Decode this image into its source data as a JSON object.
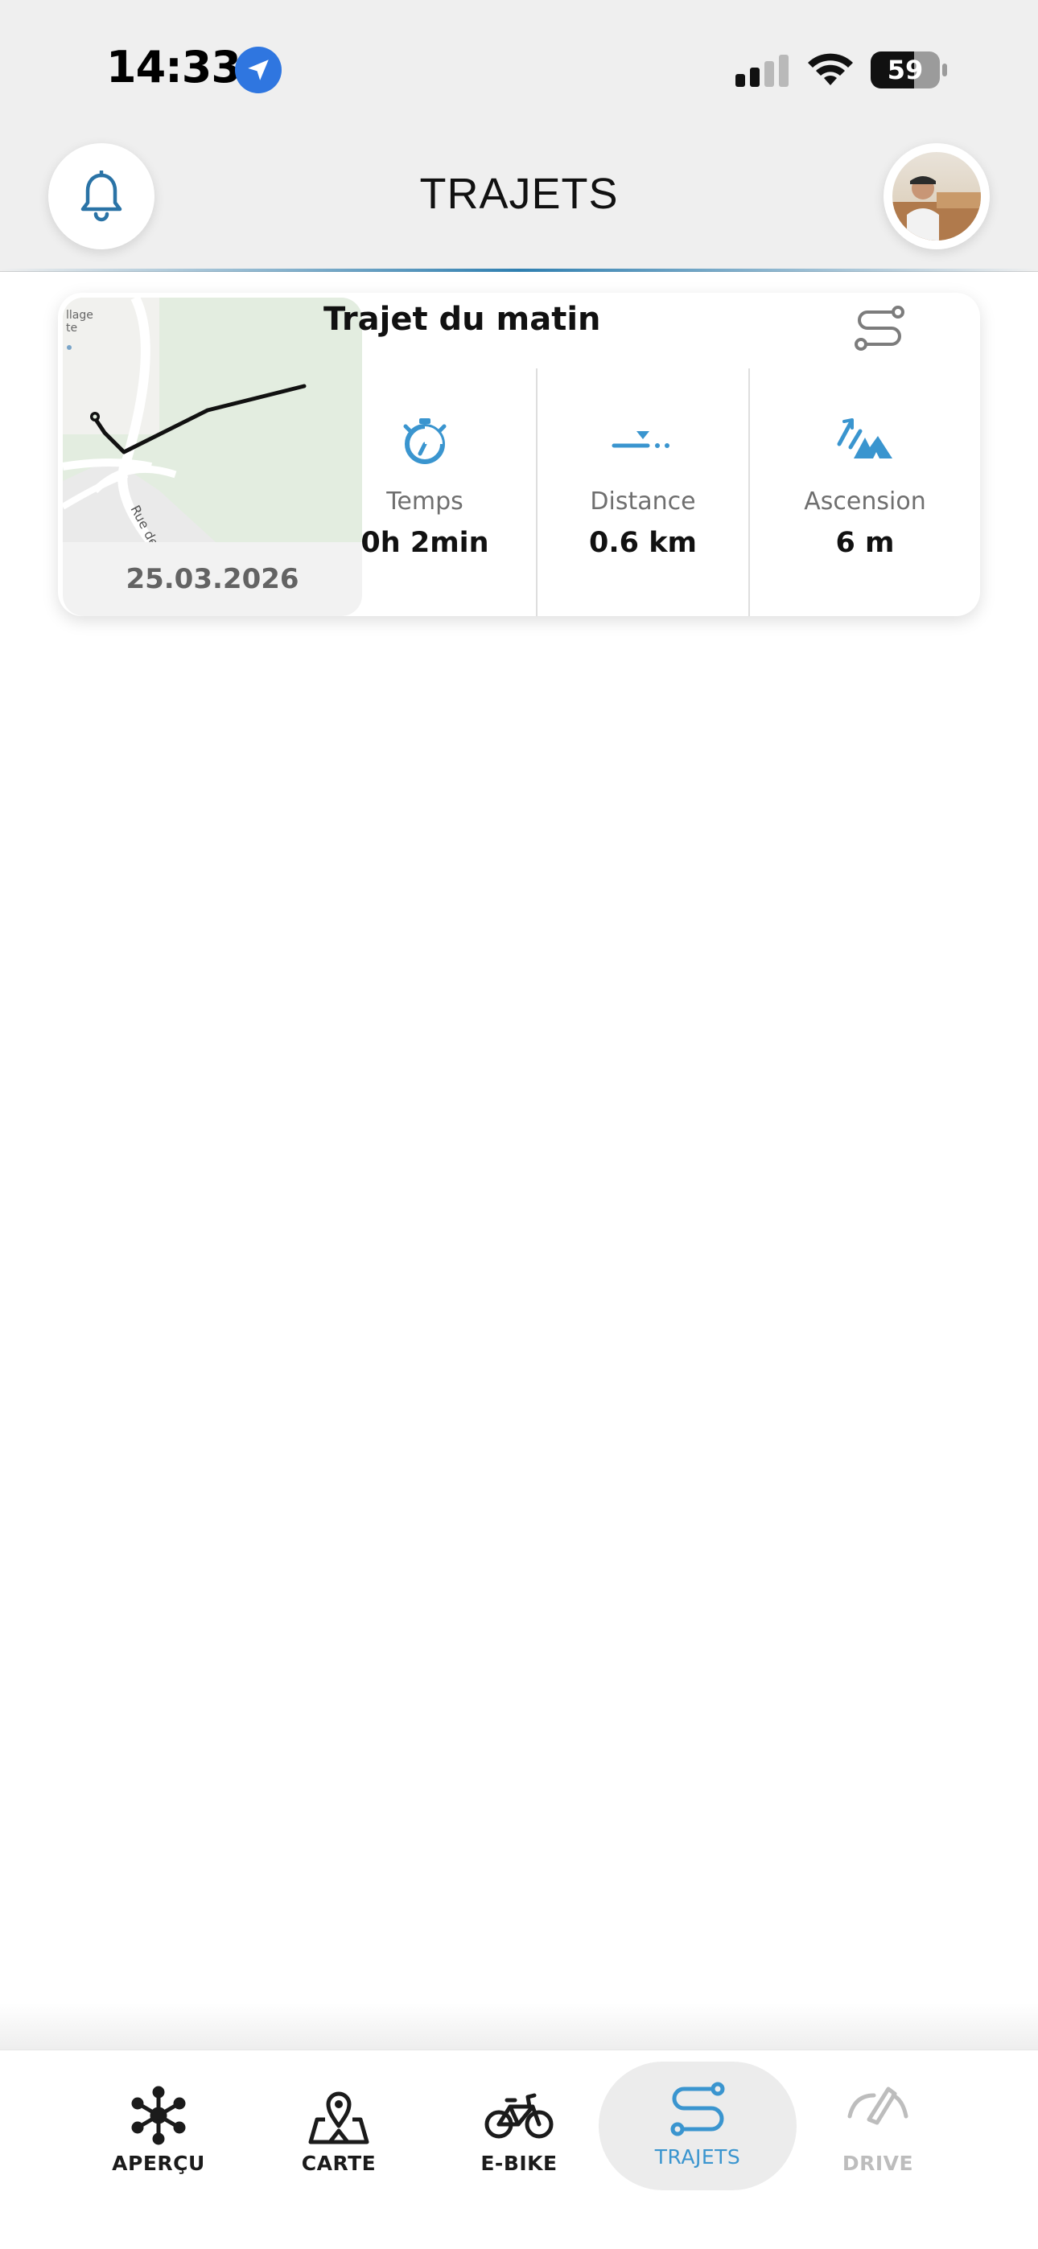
{
  "status_bar": {
    "time": "14:33",
    "battery": "59"
  },
  "header": {
    "title": "TRAJETS"
  },
  "rides": [
    {
      "title": "Trajet du matin",
      "date": "25.03.2026",
      "map_street_label": "Rue de",
      "map_place_label": "llage\nte",
      "stats": [
        {
          "label": "Temps",
          "value": "0h 2min",
          "icon": "stopwatch-icon"
        },
        {
          "label": "Distance",
          "value": "0.6 km",
          "icon": "distance-icon"
        },
        {
          "label": "Ascension",
          "value": "6 m",
          "icon": "mountain-icon"
        }
      ]
    }
  ],
  "bottom_nav": {
    "items": [
      {
        "label": "APERÇU",
        "icon": "overview-hub-icon",
        "state": "normal"
      },
      {
        "label": "CARTE",
        "icon": "map-pin-icon",
        "state": "normal"
      },
      {
        "label": "E-BIKE",
        "icon": "bicycle-icon",
        "state": "normal"
      },
      {
        "label": "TRAJETS",
        "icon": "routes-icon",
        "state": "active"
      },
      {
        "label": "DRIVE",
        "icon": "drive-icon",
        "state": "disabled"
      }
    ]
  },
  "colors": {
    "accent": "#3a95cf",
    "header_bg": "#efefef",
    "location_badge": "#2f76e0"
  }
}
